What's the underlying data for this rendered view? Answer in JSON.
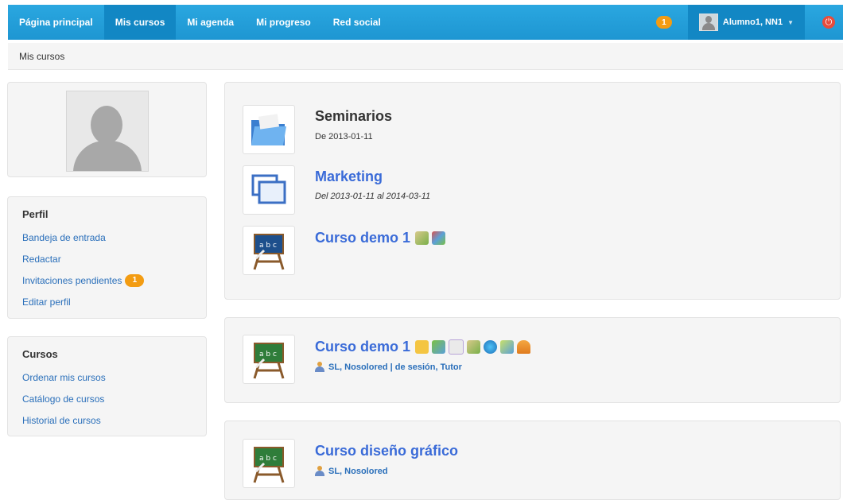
{
  "nav": {
    "items": [
      "Página principal",
      "Mis cursos",
      "Mi agenda",
      "Mi progreso",
      "Red social"
    ],
    "notifications": "1",
    "user": "Alumno1, NN1"
  },
  "breadcrumb": "Mis cursos",
  "profile": {
    "title": "Perfil",
    "links": [
      "Bandeja de entrada",
      "Redactar",
      "Invitaciones pendientes",
      "Editar perfil"
    ],
    "pending_count": "1"
  },
  "courses_menu": {
    "title": "Cursos",
    "links": [
      "Ordenar mis cursos",
      "Catálogo de cursos",
      "Historial de cursos"
    ]
  },
  "session_block": {
    "category": {
      "title": "Seminarios",
      "date": "De 2013-01-11"
    },
    "session": {
      "title": "Marketing",
      "date": "Del 2013-01-11 al 2014-03-11"
    },
    "course": {
      "title": "Curso demo 1"
    }
  },
  "course1": {
    "title": "Curso demo 1",
    "teacher": "SL, Nosolored | de sesión, Tutor"
  },
  "course2": {
    "title": "Curso diseño gráfico",
    "teacher": "SL, Nosolored"
  },
  "colors": {
    "nav_bg": "#1e96d2",
    "link": "#2a6fba",
    "title_link": "#3a6bd8",
    "badge": "#f39c12"
  },
  "icons": [
    "folder-icon",
    "window-icon",
    "chalkboard-icon",
    "power-icon",
    "user-icon"
  ]
}
